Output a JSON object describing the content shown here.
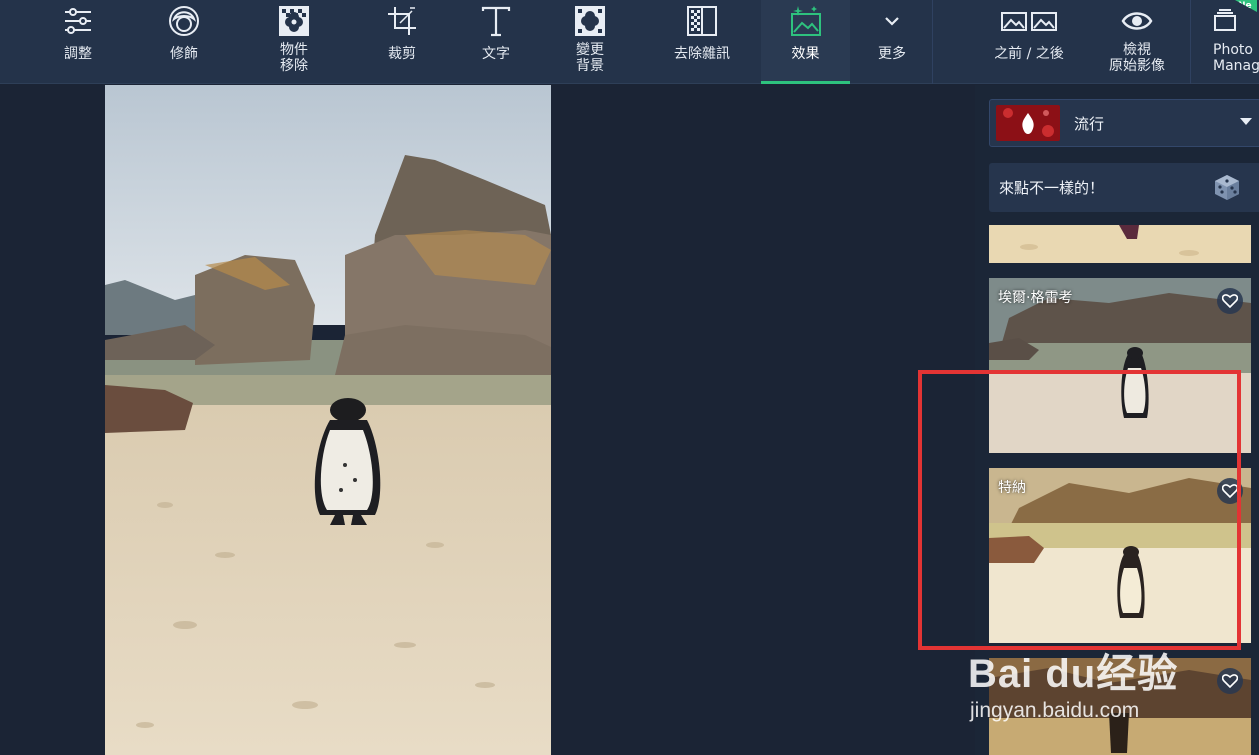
{
  "toolbar": {
    "tools": [
      {
        "label": "調整",
        "icon": "sliders-icon"
      },
      {
        "label": "修飾",
        "icon": "face-retouch-icon"
      },
      {
        "label": "物件\n移除",
        "icon": "object-removal-icon"
      },
      {
        "label": "裁剪",
        "icon": "crop-icon"
      },
      {
        "label": "文字",
        "icon": "text-icon"
      },
      {
        "label": "變更\n背景",
        "icon": "change-background-icon"
      },
      {
        "label": "去除雜訊",
        "icon": "denoise-icon"
      },
      {
        "label": "效果",
        "icon": "effects-icon",
        "active": true
      },
      {
        "label": "更多",
        "icon": "chevron-down-icon"
      },
      {
        "label": "之前 / 之後",
        "icon": "before-after-icon"
      },
      {
        "label": "檢視\n原始影像",
        "icon": "eye-icon"
      },
      {
        "label": "Photo\nManage",
        "icon": "photo-manager-icon",
        "badge": "Ne"
      }
    ]
  },
  "panel": {
    "category": "流行",
    "random_label": "來點不一樣的！",
    "effects": [
      {
        "name": "",
        "favorite": false
      },
      {
        "name": "埃爾·格雷考",
        "favorite": false
      },
      {
        "name": "特納",
        "favorite": false
      },
      {
        "name": "",
        "favorite": false
      }
    ]
  },
  "watermark": {
    "brand": "Bai du经验",
    "url": "jingyan.baidu.com"
  },
  "colors": {
    "toolbar_bg": "#24334a",
    "app_bg": "#1b2435",
    "accent": "#2ec27e",
    "highlight": "#e33434"
  }
}
